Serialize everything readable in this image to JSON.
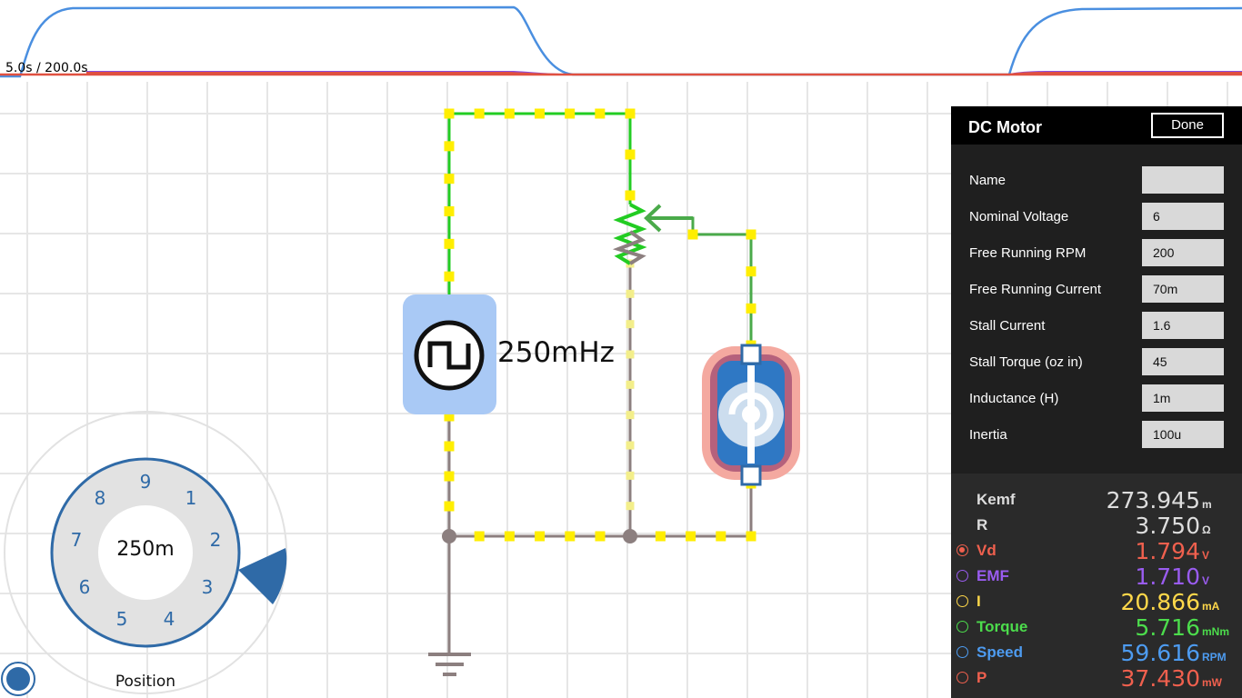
{
  "scope": {
    "time_label": "5.0s / 200.0s",
    "colors": {
      "speed": "#4a8fe0",
      "emf": "#8a4ce0",
      "vd": "#e05040"
    }
  },
  "circuit": {
    "source_frequency_label": "250mHz",
    "wire_active_color": "#22cc22",
    "wire_idle_color": "#8c7f7f",
    "current_dot_color": "#ffee00"
  },
  "dial": {
    "center_value": "250m",
    "numbers": [
      "9",
      "1",
      "2",
      "3",
      "4",
      "5",
      "6",
      "7",
      "8"
    ],
    "label": "Position",
    "accent_color": "#2f6aa7"
  },
  "panel": {
    "title": "DC Motor",
    "done_label": "Done",
    "properties": [
      {
        "label": "Name",
        "value": ""
      },
      {
        "label": "Nominal Voltage",
        "value": "6"
      },
      {
        "label": "Free Running RPM",
        "value": "200"
      },
      {
        "label": "Free Running Current",
        "value": "70m"
      },
      {
        "label": "Stall Current",
        "value": "1.6"
      },
      {
        "label": "Stall Torque (oz in)",
        "value": "45"
      },
      {
        "label": "Inductance (H)",
        "value": "1m"
      },
      {
        "label": "Inertia",
        "value": "100u"
      }
    ],
    "readouts": [
      {
        "label": "Kemf",
        "value": "273.945",
        "unit": "m",
        "color": "#dddddd",
        "label_color": "#dddddd",
        "radio": false,
        "radio_on": false
      },
      {
        "label": "R",
        "value": "3.750",
        "unit": "Ω",
        "color": "#dddddd",
        "label_color": "#dddddd",
        "radio": false,
        "radio_on": false
      },
      {
        "label": "Vd",
        "value": "1.794",
        "unit": "V",
        "color": "#f0604e",
        "label_color": "#f0604e",
        "radio": true,
        "radio_on": true
      },
      {
        "label": "EMF",
        "value": "1.710",
        "unit": "V",
        "color": "#9a5cf0",
        "label_color": "#9a5cf0",
        "radio": true,
        "radio_on": false
      },
      {
        "label": "I",
        "value": "20.866",
        "unit": "mA",
        "color": "#ffd84a",
        "label_color": "#ffd84a",
        "radio": true,
        "radio_on": false
      },
      {
        "label": "Torque",
        "value": "5.716",
        "unit": "mNm",
        "color": "#4cdc4c",
        "label_color": "#4cdc4c",
        "radio": true,
        "radio_on": false
      },
      {
        "label": "Speed",
        "value": "59.616",
        "unit": "RPM",
        "color": "#4d9bf0",
        "label_color": "#4d9bf0",
        "radio": true,
        "radio_on": false
      },
      {
        "label": "P",
        "value": "37.430",
        "unit": "mW",
        "color": "#f0604e",
        "label_color": "#f0604e",
        "radio": true,
        "radio_on": false
      }
    ]
  }
}
